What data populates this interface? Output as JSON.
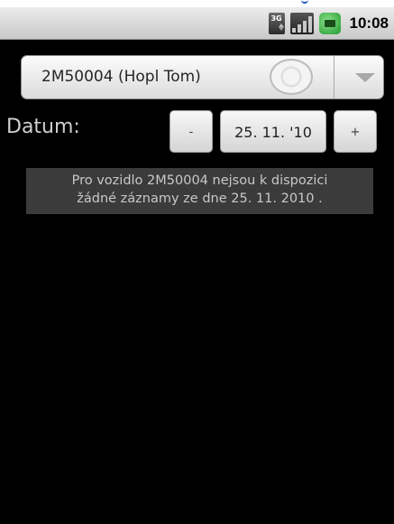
{
  "status_bar": {
    "network_icon": "3g-data-icon",
    "network_text": "3G",
    "signal_icon": "signal-strength-icon",
    "battery_icon": "battery-charging-icon",
    "time": "10:08"
  },
  "vehicle_spinner": {
    "selected": "2M50004 (Hopl Tom)",
    "ring_icon": "radio-ring-icon",
    "dropdown_icon": "chevron-down-icon"
  },
  "date_row": {
    "label": "Datum:",
    "minus_label": "-",
    "date_value": "25. 11. '10",
    "plus_label": "+"
  },
  "message": {
    "line1": "Pro vozidlo 2M50004 nejsou k dispozici",
    "line2": "žádné záznamy ze dne 25. 11. 2010 ."
  }
}
